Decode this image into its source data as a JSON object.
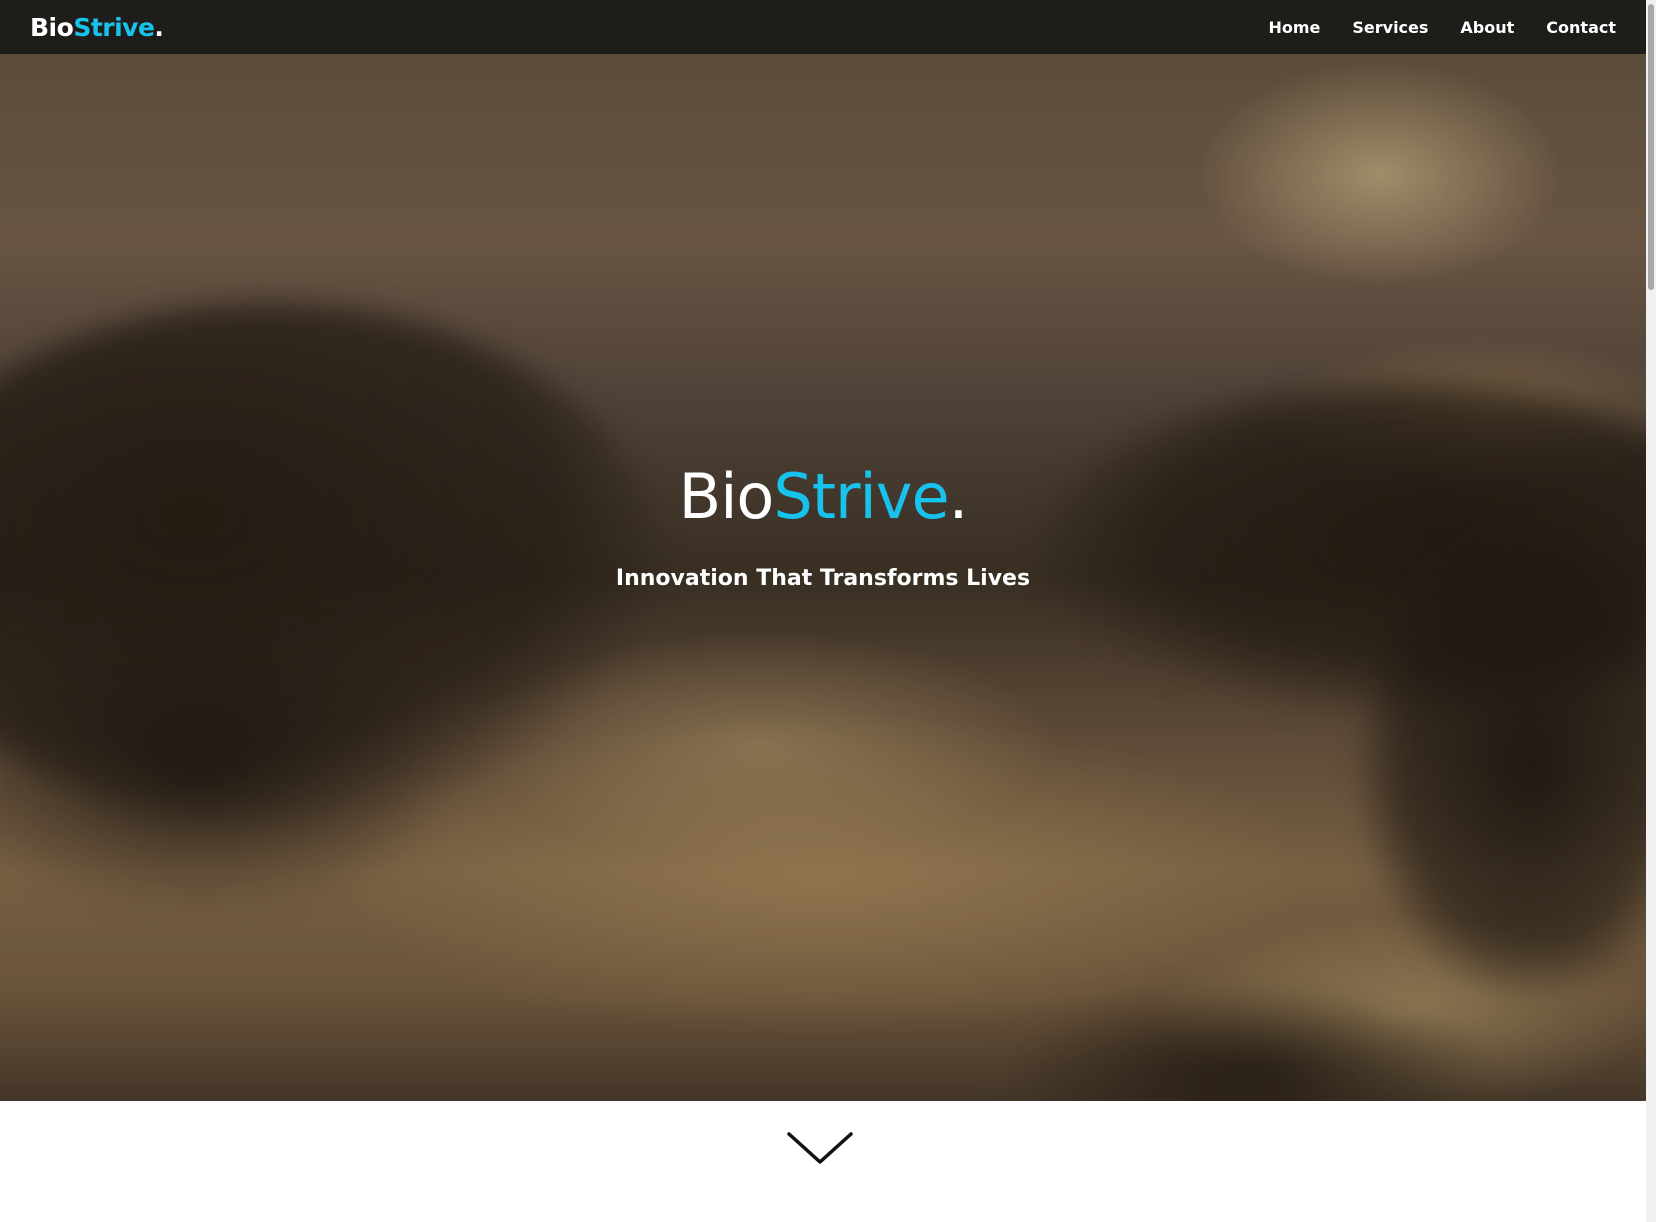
{
  "brand": {
    "prefix": "Bio",
    "accent": "Strive",
    "suffix": "."
  },
  "nav": {
    "items": [
      {
        "label": "Home"
      },
      {
        "label": "Services"
      },
      {
        "label": "About"
      },
      {
        "label": "Contact"
      }
    ]
  },
  "hero": {
    "title_prefix": "Bio",
    "title_accent": "Strive",
    "title_suffix": ".",
    "tagline": "Innovation That Transforms Lives"
  },
  "icons": {
    "scroll_down": "chevron-down-icon"
  },
  "colors": {
    "accent": "#17c3ec",
    "navbar_bg": "#1f1d1a",
    "text_light": "#ffffff"
  }
}
